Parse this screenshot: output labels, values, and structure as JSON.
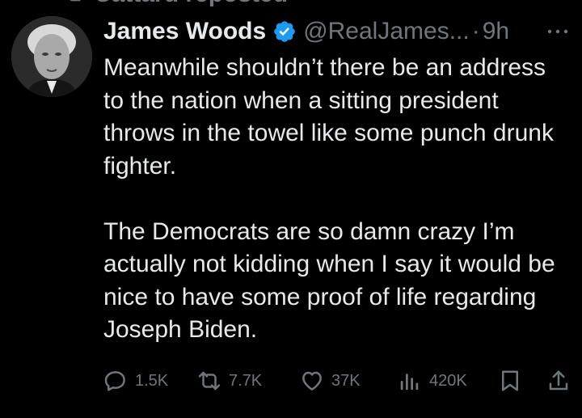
{
  "repost": {
    "text": "Cattard reposted"
  },
  "tweet": {
    "author": {
      "display_name": "James Woods",
      "handle": "@RealJames...",
      "verified": true
    },
    "separator": "·",
    "time": "9h",
    "paragraphs": [
      "Meanwhile shouldn’t there be an address to the nation when a sitting president throws in the towel like some punch drunk fighter.",
      "The Democrats are so damn crazy I’m actually not kidding when I say it would be nice to have some proof of life regarding Joseph Biden."
    ],
    "actions": {
      "replies": "1.5K",
      "reposts": "7.7K",
      "likes": "37K",
      "views": "420K"
    }
  },
  "colors": {
    "background": "#000000",
    "text": "#e7e9ea",
    "secondary": "#71767b",
    "verified": "#1d9bf0"
  },
  "icons": [
    "repost-icon",
    "verified-badge-icon",
    "more-icon",
    "reply-icon",
    "retweet-icon",
    "like-icon",
    "views-icon",
    "bookmark-icon",
    "share-icon"
  ]
}
